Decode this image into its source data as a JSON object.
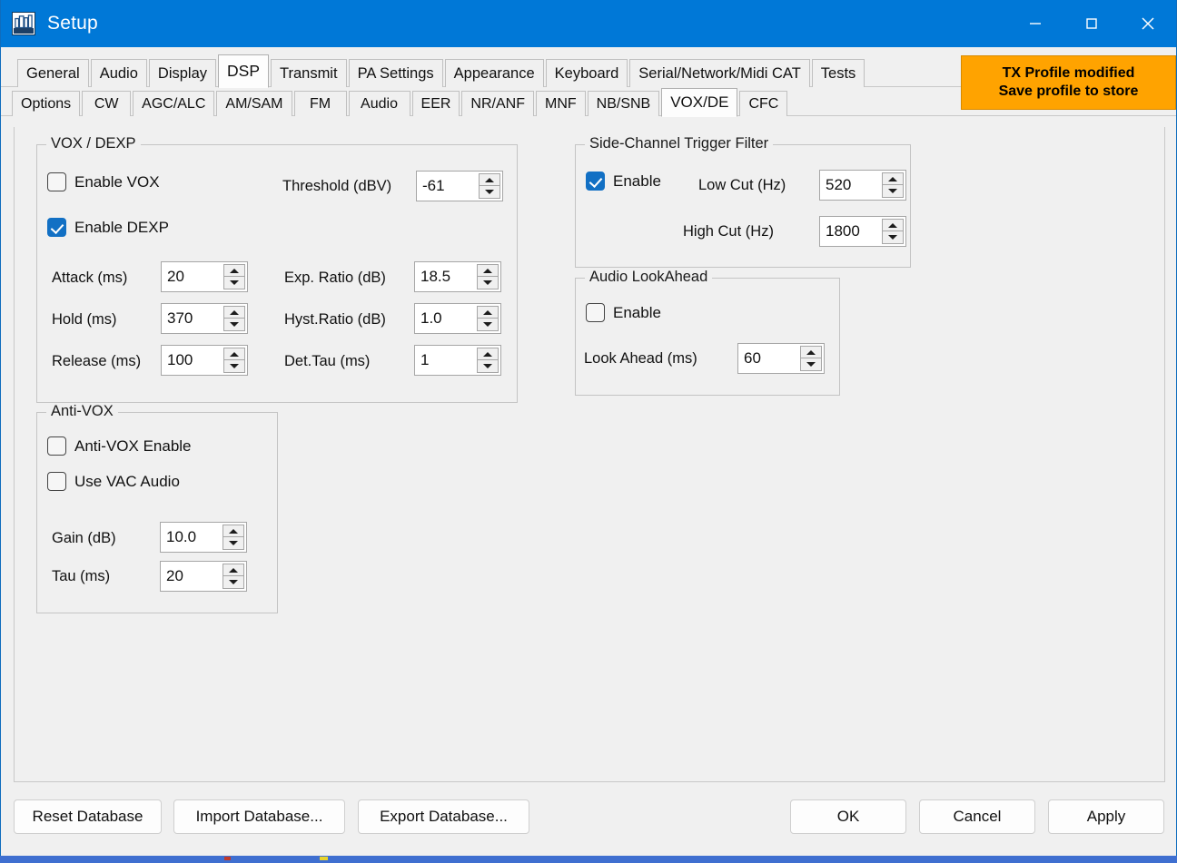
{
  "window": {
    "title": "Setup",
    "icon": "app-icon",
    "controls": {
      "minimize": "minimize-icon",
      "maximize": "maximize-icon",
      "close": "close-icon"
    },
    "accent_color": "#0078d7"
  },
  "tabs_primary": {
    "items": [
      "General",
      "Audio",
      "Display",
      "DSP",
      "Transmit",
      "PA Settings",
      "Appearance",
      "Keyboard",
      "Serial/Network/Midi CAT",
      "Tests"
    ],
    "selected": "DSP"
  },
  "tabs_secondary": {
    "items": [
      "Options",
      "CW",
      "AGC/ALC",
      "AM/SAM",
      "FM",
      "Audio",
      "EER",
      "NR/ANF",
      "MNF",
      "NB/SNB",
      "VOX/DE",
      "CFC"
    ],
    "selected": "VOX/DE"
  },
  "tx_banner": {
    "line1": "TX Profile modified",
    "line2": "Save profile to store",
    "color": "#ffa300"
  },
  "vox_dexp": {
    "legend": "VOX / DEXP",
    "enable_vox": {
      "label": "Enable VOX",
      "checked": false
    },
    "enable_dexp": {
      "label": "Enable DEXP",
      "checked": true
    },
    "threshold": {
      "label": "Threshold (dBV)",
      "value": "-61"
    },
    "attack": {
      "label": "Attack (ms)",
      "value": "20"
    },
    "hold": {
      "label": "Hold (ms)",
      "value": "370"
    },
    "release": {
      "label": "Release (ms)",
      "value": "100"
    },
    "exp_ratio": {
      "label": "Exp. Ratio (dB)",
      "value": "18.5"
    },
    "hyst_ratio": {
      "label": "Hyst.Ratio (dB)",
      "value": "1.0"
    },
    "det_tau": {
      "label": "Det.Tau (ms)",
      "value": "1"
    }
  },
  "anti_vox": {
    "legend": "Anti-VOX",
    "enable": {
      "label": "Anti-VOX Enable",
      "checked": false
    },
    "use_vac_audio": {
      "label": "Use VAC Audio",
      "checked": false
    },
    "gain": {
      "label": "Gain (dB)",
      "value": "10.0"
    },
    "tau": {
      "label": "Tau (ms)",
      "value": "20"
    }
  },
  "side_channel": {
    "legend": "Side-Channel Trigger Filter",
    "enable": {
      "label": "Enable",
      "checked": true
    },
    "low_cut": {
      "label": "Low  Cut (Hz)",
      "value": "520"
    },
    "high_cut": {
      "label": "High Cut (Hz)",
      "value": "1800"
    }
  },
  "audio_look_ahead": {
    "legend": "Audio LookAhead",
    "enable": {
      "label": "Enable",
      "checked": false
    },
    "look_ahead": {
      "label": "Look Ahead (ms)",
      "value": "60"
    }
  },
  "footer": {
    "reset_database": "Reset Database",
    "import_database": "Import Database...",
    "export_database": "Export Database...",
    "ok": "OK",
    "cancel": "Cancel",
    "apply": "Apply"
  }
}
